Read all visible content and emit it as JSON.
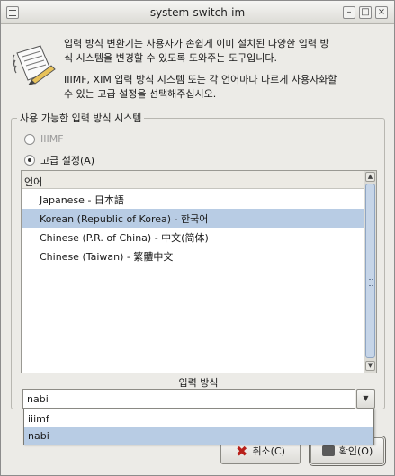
{
  "window": {
    "title": "system-switch-im"
  },
  "header": {
    "line1": "입력 방식 변환기는 사용자가 손쉽게 이미 설치된 다양한 입력 방",
    "line2": "식 시스템을 변경할 수 있도록 도와주는 도구입니다.",
    "line3": "IIIMF, XIM 입력 방식 시스템 또는 각 언어마다 다르게 사용자화할",
    "line4": "수 있는 고급 설정을 선택해주십시오."
  },
  "frame": {
    "label": "사용 가능한 입력 방식 시스템",
    "options": [
      {
        "label": "IIIMF",
        "selected": false,
        "enabled": false
      },
      {
        "label": "고급 설정(A)",
        "selected": true,
        "enabled": true
      }
    ]
  },
  "language_list": {
    "header": "언어",
    "rows": [
      {
        "label": "Japanese  -  日本語",
        "selected": false
      },
      {
        "label": "Korean (Republic of Korea)  -  한국어",
        "selected": true
      },
      {
        "label": "Chinese (P.R. of China)  -  中文(简体)",
        "selected": false
      },
      {
        "label": "Chinese (Taiwan)  -  繁體中文",
        "selected": false
      }
    ]
  },
  "input_method": {
    "label": "입력 방식",
    "value": "nabi",
    "options": [
      {
        "label": "iiimf",
        "selected": false
      },
      {
        "label": "nabi",
        "selected": true
      }
    ]
  },
  "buttons": {
    "cancel": "취소(C)",
    "ok": "확인(O)"
  },
  "icons": {
    "header": "notepad-pen-icon",
    "window_menu": "window-menu-icon"
  },
  "colors": {
    "selection": "#b8cce4",
    "scroll_thumb": "#c6d5e8",
    "background": "#ecebe7"
  }
}
